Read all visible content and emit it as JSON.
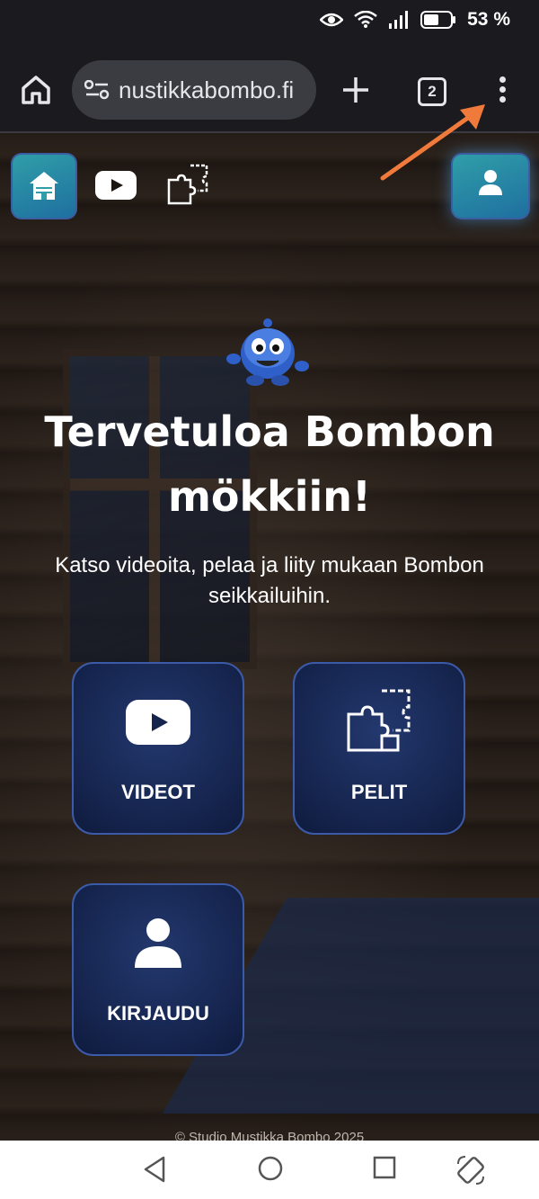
{
  "status_bar": {
    "battery_percent": "53 %",
    "icons": [
      "eye-icon",
      "wifi-icon",
      "signal-icon",
      "battery-icon"
    ]
  },
  "browser": {
    "url": "nustikkabombo.fi",
    "tab_count": "2",
    "icons": [
      "home-icon",
      "site-settings-icon",
      "plus-icon",
      "tabs-icon",
      "more-vert-icon"
    ]
  },
  "page": {
    "top_nav": {
      "items": [
        "house-icon",
        "youtube-icon",
        "puzzle-icon",
        "user-icon"
      ]
    },
    "title": "Tervetuloa Bombon mökkiin!",
    "subtitle": "Katso videoita, pelaa ja liity mukaan Bombon seikkailuihin.",
    "tiles": [
      {
        "label": "VIDEOT",
        "icon": "youtube-icon"
      },
      {
        "label": "PELIT",
        "icon": "puzzle-icon"
      },
      {
        "label": "KIRJAUDU",
        "icon": "user-icon"
      }
    ],
    "footer": "© Studio Mustikka Bombo 2025"
  },
  "colors": {
    "accent_teal": "#2f9ea8",
    "tile_navy": "#15244d",
    "annotation_arrow": "#f07a3c"
  },
  "android_nav": [
    "back-icon",
    "home-icon",
    "recents-icon",
    "rotate-icon"
  ]
}
